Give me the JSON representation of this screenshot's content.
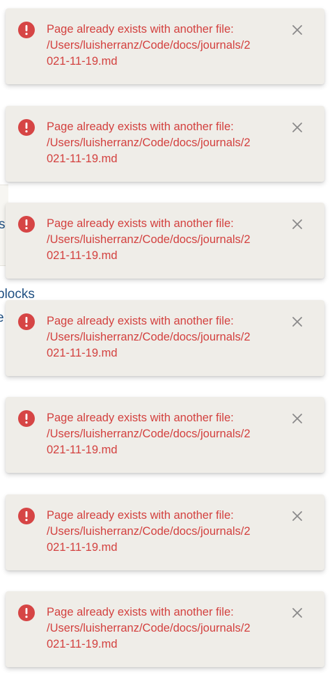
{
  "background": {
    "fragments": [
      {
        "text": "(",
        "style": "dark"
      },
      {
        "text": "s",
        "style": "link"
      },
      {
        "text": "blocks",
        "style": "link"
      },
      {
        "text": "e",
        "style": "link"
      }
    ]
  },
  "notifications": [
    {
      "line1": "Page already exists with another file:",
      "line2": "/Users/luisherranz/Code/docs/journals/2",
      "line3": "021-11-19.md",
      "icon": "exclamation-circle-icon",
      "close_icon": "close-icon"
    },
    {
      "line1": "Page already exists with another file:",
      "line2": "/Users/luisherranz/Code/docs/journals/2",
      "line3": "021-11-19.md",
      "icon": "exclamation-circle-icon",
      "close_icon": "close-icon"
    },
    {
      "line1": "Page already exists with another file:",
      "line2": "/Users/luisherranz/Code/docs/journals/2",
      "line3": "021-11-19.md",
      "icon": "exclamation-circle-icon",
      "close_icon": "close-icon"
    },
    {
      "line1": "Page already exists with another file:",
      "line2": "/Users/luisherranz/Code/docs/journals/2",
      "line3": "021-11-19.md",
      "icon": "exclamation-circle-icon",
      "close_icon": "close-icon"
    },
    {
      "line1": "Page already exists with another file:",
      "line2": "/Users/luisherranz/Code/docs/journals/2",
      "line3": "021-11-19.md",
      "icon": "exclamation-circle-icon",
      "close_icon": "close-icon"
    },
    {
      "line1": "Page already exists with another file:",
      "line2": "/Users/luisherranz/Code/docs/journals/2",
      "line3": "021-11-19.md",
      "icon": "exclamation-circle-icon",
      "close_icon": "close-icon"
    },
    {
      "line1": "Page already exists with another file:",
      "line2": "/Users/luisherranz/Code/docs/journals/2",
      "line3": "021-11-19.md",
      "icon": "exclamation-circle-icon",
      "close_icon": "close-icon"
    }
  ],
  "colors": {
    "toast_background": "#efede8",
    "error_text": "#d3413f",
    "error_icon": "#d64545",
    "close_icon": "#8a8a8a",
    "background_link": "#1f4f82"
  }
}
